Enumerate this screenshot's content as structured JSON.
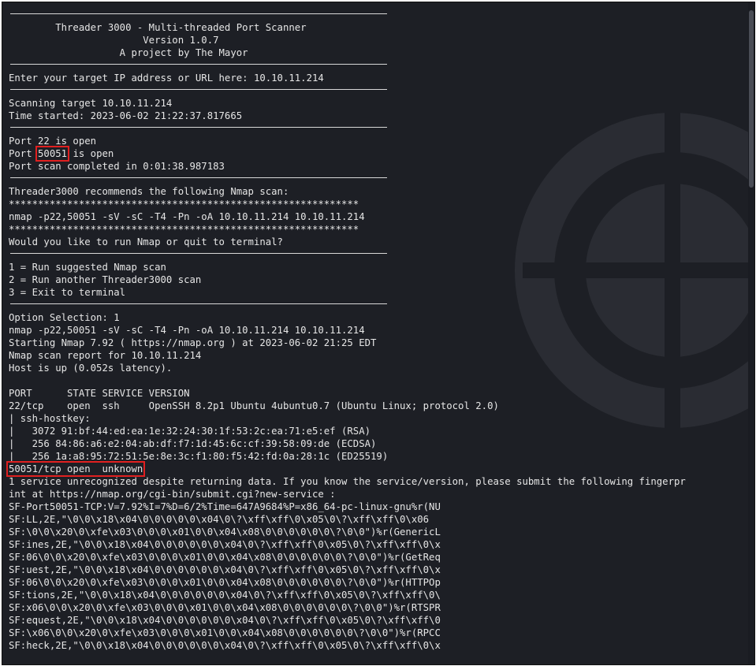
{
  "lines": [
    {
      "t": "hr"
    },
    {
      "t": "text",
      "v": "        Threader 3000 - Multi-threaded Port Scanner"
    },
    {
      "t": "text",
      "v": "                       Version 1.0.7"
    },
    {
      "t": "text",
      "v": "                   A project by The Mayor"
    },
    {
      "t": "hr"
    },
    {
      "t": "text",
      "v": "Enter your target IP address or URL here: 10.10.11.214"
    },
    {
      "t": "hr"
    },
    {
      "t": "text",
      "v": "Scanning target 10.10.11.214"
    },
    {
      "t": "text",
      "v": "Time started: 2023-06-02 21:22:37.817665"
    },
    {
      "t": "hr"
    },
    {
      "t": "text",
      "v": "Port 22 is open"
    },
    {
      "t": "hl",
      "pre": "Port ",
      "mark": "50051",
      "post": " is open"
    },
    {
      "t": "text",
      "v": "Port scan completed in 0:01:38.987183"
    },
    {
      "t": "hr"
    },
    {
      "t": "text",
      "v": "Threader3000 recommends the following Nmap scan:"
    },
    {
      "t": "text",
      "v": "************************************************************"
    },
    {
      "t": "text",
      "v": "nmap -p22,50051 -sV -sC -T4 -Pn -oA 10.10.11.214 10.10.11.214"
    },
    {
      "t": "text",
      "v": "************************************************************"
    },
    {
      "t": "text",
      "v": "Would you like to run Nmap or quit to terminal?"
    },
    {
      "t": "hr"
    },
    {
      "t": "text",
      "v": "1 = Run suggested Nmap scan"
    },
    {
      "t": "text",
      "v": "2 = Run another Threader3000 scan"
    },
    {
      "t": "text",
      "v": "3 = Exit to terminal"
    },
    {
      "t": "hr"
    },
    {
      "t": "text",
      "v": "Option Selection: 1"
    },
    {
      "t": "text",
      "v": "nmap -p22,50051 -sV -sC -T4 -Pn -oA 10.10.11.214 10.10.11.214"
    },
    {
      "t": "text",
      "v": "Starting Nmap 7.92 ( https://nmap.org ) at 2023-06-02 21:25 EDT"
    },
    {
      "t": "text",
      "v": "Nmap scan report for 10.10.11.214"
    },
    {
      "t": "text",
      "v": "Host is up (0.052s latency)."
    },
    {
      "t": "text",
      "v": ""
    },
    {
      "t": "text",
      "v": "PORT      STATE SERVICE VERSION"
    },
    {
      "t": "text",
      "v": "22/tcp    open  ssh     OpenSSH 8.2p1 Ubuntu 4ubuntu0.7 (Ubuntu Linux; protocol 2.0)"
    },
    {
      "t": "text",
      "v": "| ssh-hostkey:"
    },
    {
      "t": "text",
      "v": "|   3072 91:bf:44:ed:ea:1e:32:24:30:1f:53:2c:ea:71:e5:ef (RSA)"
    },
    {
      "t": "text",
      "v": "|   256 84:86:a6:e2:04:ab:df:f7:1d:45:6c:cf:39:58:09:de (ECDSA)"
    },
    {
      "t": "text",
      "v": "|_  256 1a:a8:95:72:51:5e:8e:3c:f1:80:f5:42:fd:0a:28:1c (ED25519)"
    },
    {
      "t": "hl",
      "pre": "",
      "mark": "50051/tcp open  unknown",
      "post": ""
    },
    {
      "t": "text",
      "v": "1 service unrecognized despite returning data. If you know the service/version, please submit the following fingerpr"
    },
    {
      "t": "text",
      "v": "int at https://nmap.org/cgi-bin/submit.cgi?new-service :"
    },
    {
      "t": "text",
      "v": "SF-Port50051-TCP:V=7.92%I=7%D=6/2%Time=647A9684%P=x86_64-pc-linux-gnu%r(NU"
    },
    {
      "t": "text",
      "v": "SF:LL,2E,\"\\0\\0\\x18\\x04\\0\\0\\0\\0\\0\\x04\\0\\?\\xff\\xff\\0\\x05\\0\\?\\xff\\xff\\0\\x06"
    },
    {
      "t": "text",
      "v": "SF:\\0\\0\\x20\\0\\xfe\\x03\\0\\0\\0\\x01\\0\\0\\x04\\x08\\0\\0\\0\\0\\0\\0\\?\\0\\0\")%r(GenericL"
    },
    {
      "t": "text",
      "v": "SF:ines,2E,\"\\0\\0\\x18\\x04\\0\\0\\0\\0\\0\\0\\x04\\0\\?\\xff\\xff\\0\\x05\\0\\?\\xff\\xff\\0\\x"
    },
    {
      "t": "text",
      "v": "SF:06\\0\\0\\x20\\0\\xfe\\x03\\0\\0\\0\\x01\\0\\0\\x04\\x08\\0\\0\\0\\0\\0\\0\\?\\0\\0\")%r(GetReq"
    },
    {
      "t": "text",
      "v": "SF:uest,2E,\"\\0\\0\\x18\\x04\\0\\0\\0\\0\\0\\0\\x04\\0\\?\\xff\\xff\\0\\x05\\0\\?\\xff\\xff\\0\\x"
    },
    {
      "t": "text",
      "v": "SF:06\\0\\0\\x20\\0\\xfe\\x03\\0\\0\\0\\x01\\0\\0\\x04\\x08\\0\\0\\0\\0\\0\\0\\?\\0\\0\")%r(HTTPOp"
    },
    {
      "t": "text",
      "v": "SF:tions,2E,\"\\0\\0\\x18\\x04\\0\\0\\0\\0\\0\\0\\x04\\0\\?\\xff\\xff\\0\\x05\\0\\?\\xff\\xff\\0\\"
    },
    {
      "t": "text",
      "v": "SF:x06\\0\\0\\x20\\0\\xfe\\x03\\0\\0\\0\\x01\\0\\0\\x04\\x08\\0\\0\\0\\0\\0\\0\\?\\0\\0\")%r(RTSPR"
    },
    {
      "t": "text",
      "v": "SF:equest,2E,\"\\0\\0\\x18\\x04\\0\\0\\0\\0\\0\\0\\x04\\0\\?\\xff\\xff\\0\\x05\\0\\?\\xff\\xff\\0"
    },
    {
      "t": "text",
      "v": "SF:\\x06\\0\\0\\x20\\0\\xfe\\x03\\0\\0\\0\\x01\\0\\0\\x04\\x08\\0\\0\\0\\0\\0\\0\\?\\0\\0\")%r(RPCC"
    },
    {
      "t": "text",
      "v": "SF:heck,2E,\"\\0\\0\\x18\\x04\\0\\0\\0\\0\\0\\0\\x04\\0\\?\\xff\\xff\\0\\x05\\0\\?\\xff\\xff\\0\\x"
    }
  ],
  "colors": {
    "background": "#1d1f25",
    "text": "#e6e6e6",
    "highlight": "#e02020"
  },
  "icons": {
    "watermark": "globe-emblem-icon"
  }
}
